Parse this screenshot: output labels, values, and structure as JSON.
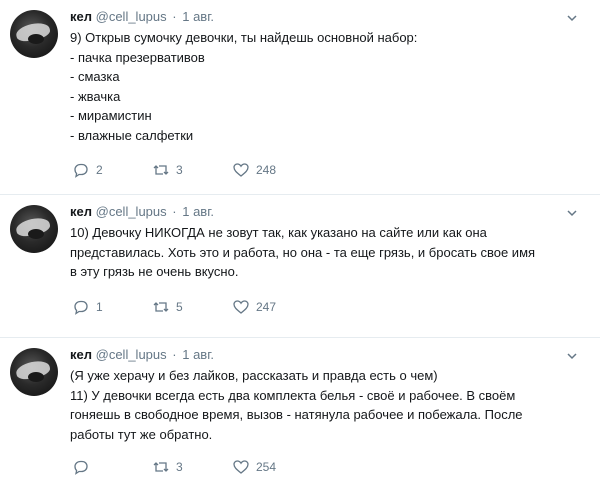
{
  "tweets": [
    {
      "name": "кел",
      "handle": "@cell_lupus",
      "dot": "·",
      "date": "1 авг.",
      "lines": [
        "9) Открыв сумочку девочки, ты найдешь основной набор:",
        "- пачка презервативов",
        "- смазка",
        "- жвачка",
        "- мирамистин",
        "- влажные салфетки"
      ],
      "replies": "2",
      "retweets": "3",
      "likes": "248"
    },
    {
      "name": "кел",
      "handle": "@cell_lupus",
      "dot": "·",
      "date": "1 авг.",
      "lines": [
        "10) Девочку НИКОГДА не зовут так, как указано на сайте или как она",
        "представилась. Хоть это и работа, но она - та еще грязь, и бросать свое имя",
        "в эту грязь не очень вкусно."
      ],
      "replies": "1",
      "retweets": "5",
      "likes": "247"
    },
    {
      "name": "кел",
      "handle": "@cell_lupus",
      "dot": "·",
      "date": "1 авг.",
      "lines": [
        "(Я уже херачу и без лайков, рассказать и правда есть о чем)",
        "11) У девочки всегда есть два комплекта белья - своё и рабочее. В своём",
        "гоняешь в свободное время, вызов - натянула рабочее и побежала. После",
        "работы тут же обратно."
      ],
      "replies": "",
      "retweets": "3",
      "likes": "254"
    }
  ],
  "icons": {
    "reply": "reply-icon",
    "retweet": "retweet-icon",
    "like": "heart-icon",
    "more": "chevron-down-icon"
  },
  "colors": {
    "text": "#14171a",
    "muted": "#657786",
    "divider": "#e6ecf0"
  }
}
